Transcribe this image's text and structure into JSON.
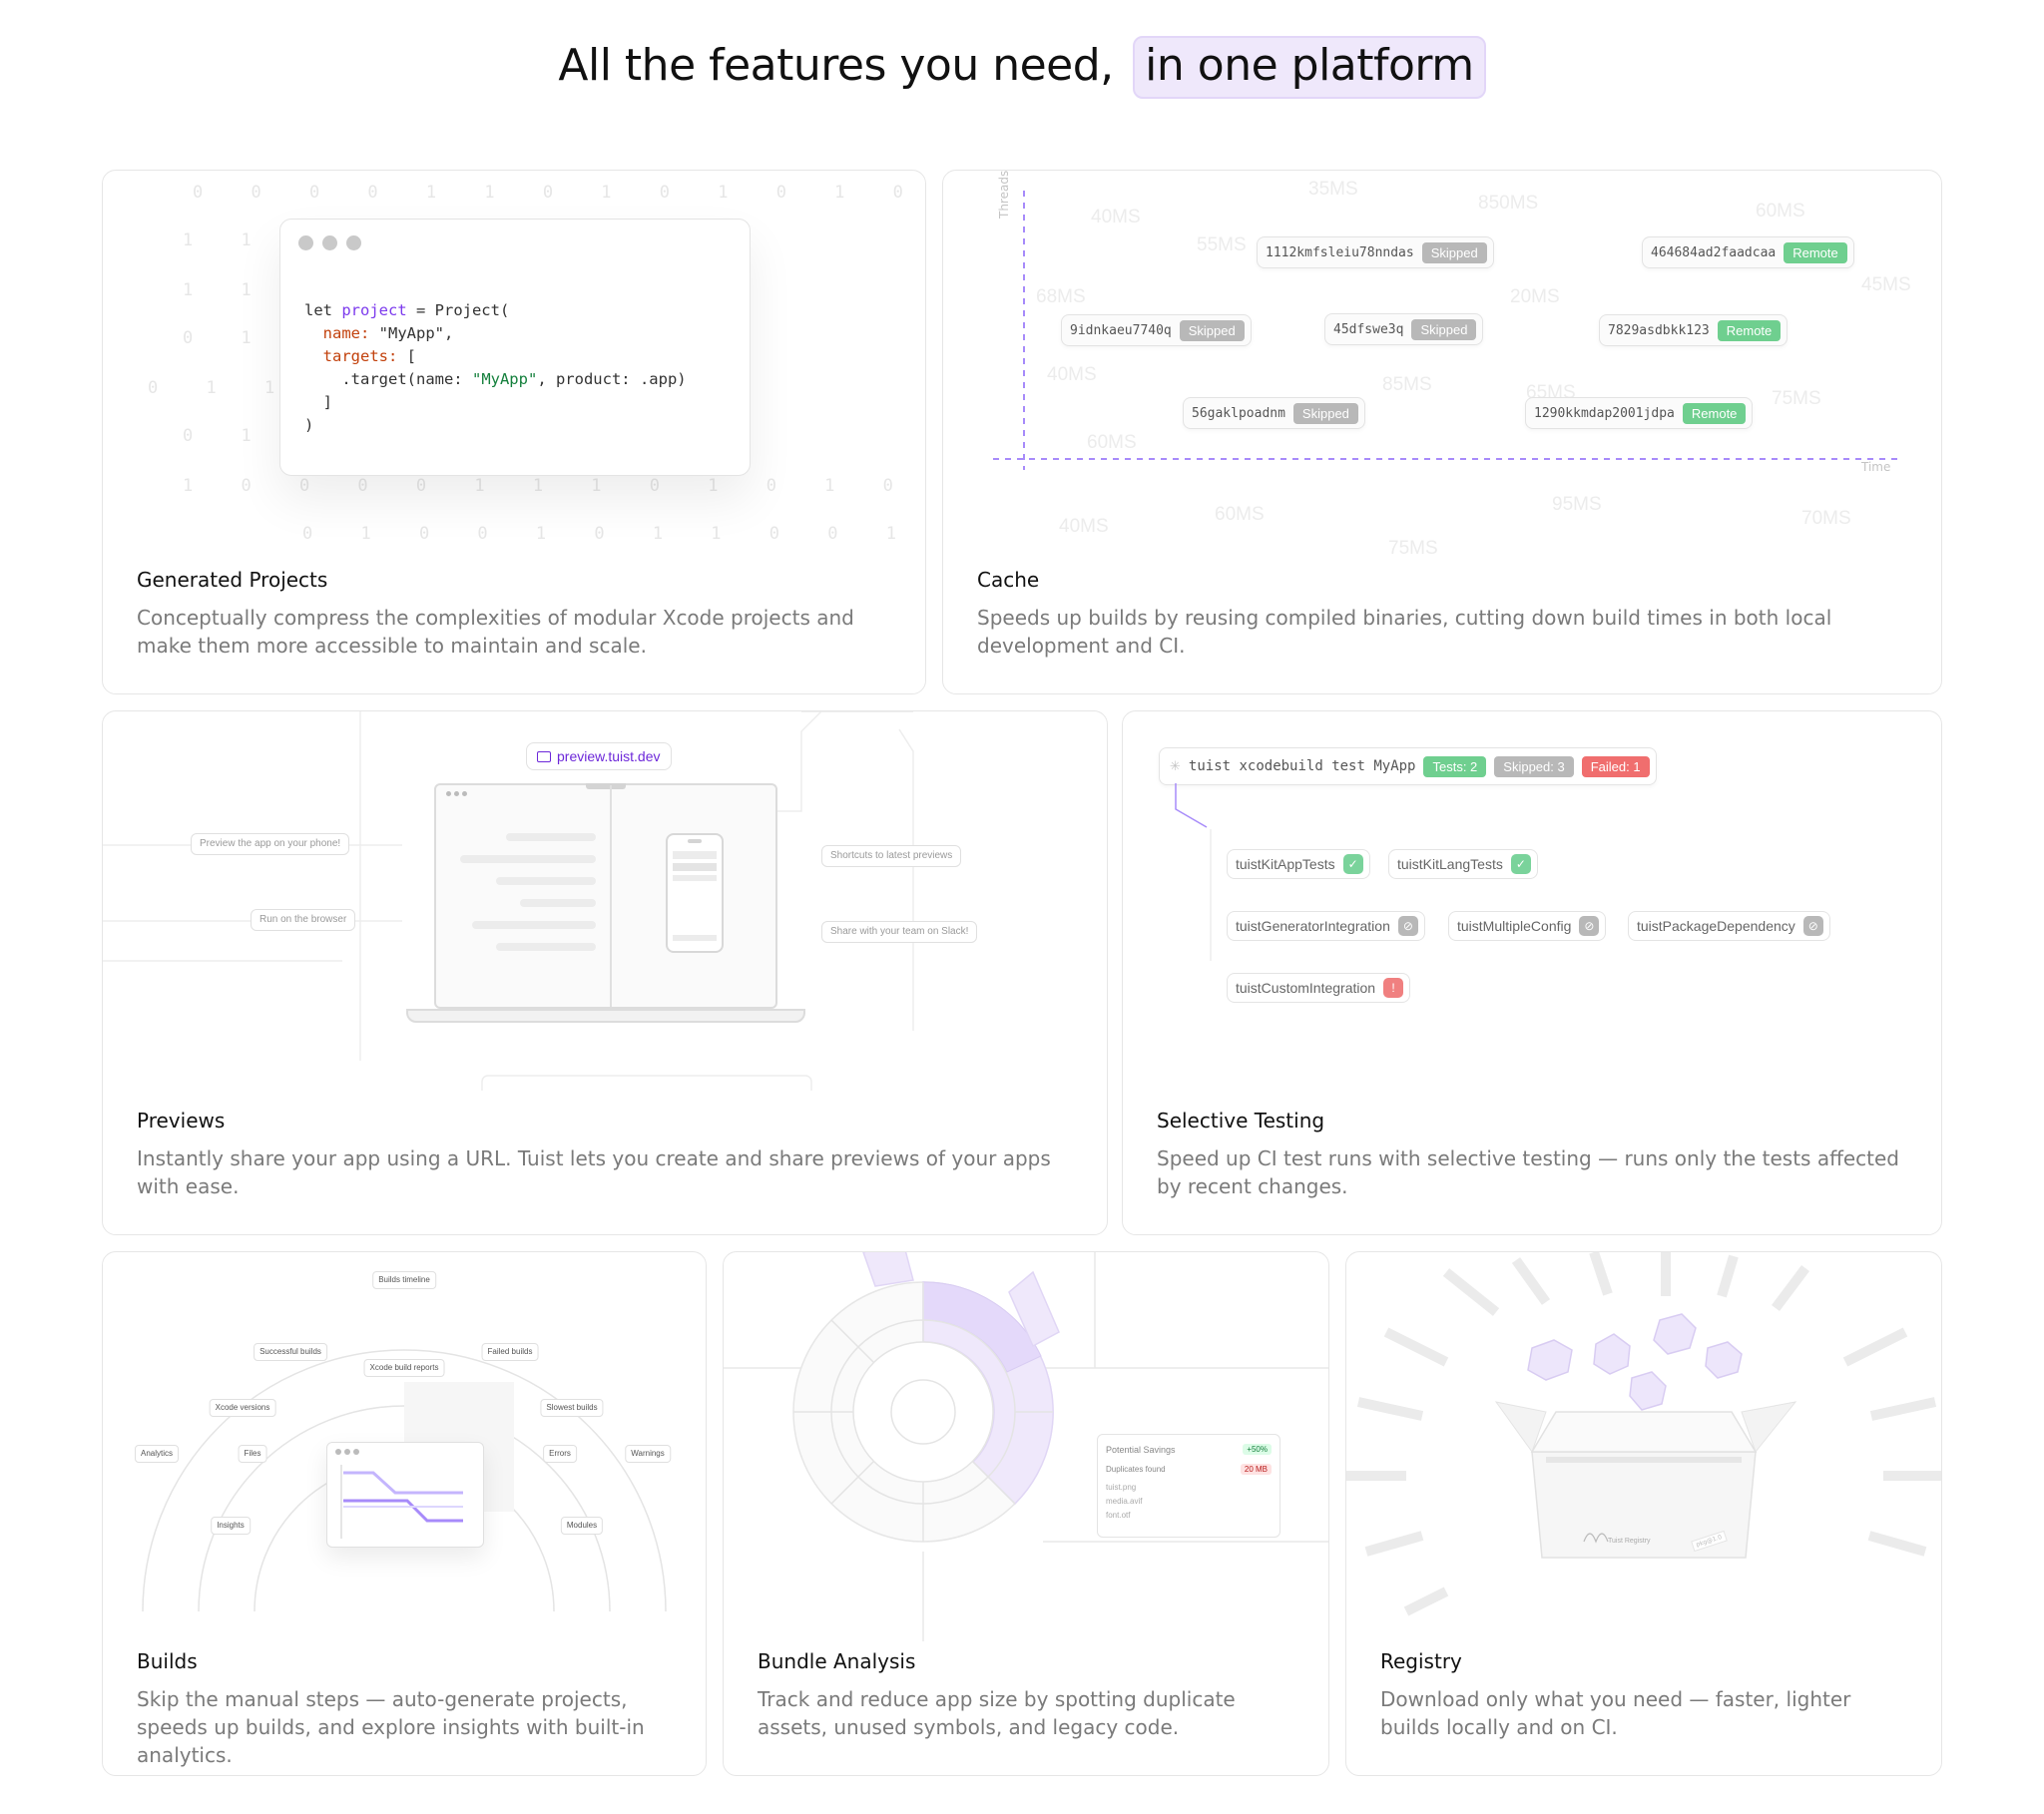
{
  "headline": {
    "prefix": "All the features you need,",
    "highlight": "in one platform"
  },
  "cards": {
    "generated": {
      "title": "Generated Projects",
      "desc": "Conceptually compress the complexities of modular Xcode projects and make them more accessible to maintain and scale.",
      "bits": [
        "0 0 0 0 1 1 0 1 0 1 0 1 0",
        "1 1 0           0 0 1 0",
        "1 1 0           0 1 0 1",
        "0 1 0           0 1 0 0",
        "0 1 1           0 1 0",
        "0 1 1           0 1 0",
        "1 0 0 0 0 1 1 1 0 1 0 1 0 1 0",
        "0 1 0 0 1 0 1 1 0 0 1 0 0"
      ]
    },
    "cache": {
      "title": "Cache",
      "desc": "Speeds up builds by reusing compiled binaries, cutting down build times in both local development and CI.",
      "axis_y": "Threads",
      "axis_x": "Time",
      "ms_labels": [
        "35MS",
        "40MS",
        "850MS",
        "60MS",
        "55MS",
        "68MS",
        "20MS",
        "45MS",
        "40MS",
        "85MS",
        "65MS",
        "75MS",
        "60MS",
        "60MS",
        "95MS",
        "40MS",
        "75MS",
        "70MS"
      ],
      "chips": [
        {
          "hash": "1112kmfsleiu78nndas",
          "status": "Skipped"
        },
        {
          "hash": "464684ad2faadcaa",
          "status": "Remote"
        },
        {
          "hash": "9idnkaeu7740q",
          "status": "Skipped"
        },
        {
          "hash": "45dfswe3q",
          "status": "Skipped"
        },
        {
          "hash": "7829asdbkk123",
          "status": "Remote"
        },
        {
          "hash": "56gaklpoadnm",
          "status": "Skipped"
        },
        {
          "hash": "1290kkmdap2001jdpa",
          "status": "Remote"
        }
      ]
    },
    "previews": {
      "title": "Previews",
      "desc": "Instantly share your app using a URL. Tuist lets you create and share previews of your apps with ease.",
      "url": "preview.tuist.dev",
      "pills": {
        "phone": "Preview the app on your phone!",
        "browser": "Run on the browser",
        "shortcuts": "Shortcuts to latest previews",
        "slack": "Share with your team on Slack!"
      }
    },
    "selective": {
      "title": "Selective Testing",
      "desc": "Speed up CI test runs with selective testing — runs only the tests affected by recent changes.",
      "command": "tuist xcodebuild test MyApp",
      "tests_badge": "Tests: 2",
      "skipped_badge": "Skipped: 3",
      "failed_badge": "Failed: 1",
      "tests": [
        {
          "name": "tuistKitAppTests",
          "status": "passed"
        },
        {
          "name": "tuistKitLangTests",
          "status": "passed"
        },
        {
          "name": "tuistGeneratorIntegration",
          "status": "skipped"
        },
        {
          "name": "tuistMultipleConfig",
          "status": "skipped"
        },
        {
          "name": "tuistPackageDependency",
          "status": "skipped"
        },
        {
          "name": "tuistCustomIntegration",
          "status": "failed"
        }
      ]
    },
    "builds": {
      "title": "Builds",
      "desc": "Skip the manual steps — auto-generate projects, speeds up builds, and explore insights with built-in analytics.",
      "labels": {
        "timeline": "Builds timeline",
        "successful": "Successful builds",
        "failed": "Failed builds",
        "reports": "Xcode build reports",
        "versions": "Xcode versions",
        "slowest": "Slowest builds",
        "analytics": "Analytics",
        "files": "Files",
        "errors": "Errors",
        "warnings": "Warnings",
        "insights": "Insights",
        "modules": "Modules"
      }
    },
    "bundle": {
      "title": "Bundle Analysis",
      "desc": "Track and reduce app size by spotting duplicate assets, unused symbols, and legacy code.",
      "panel": {
        "savings_label": "Potential Savings",
        "savings_value": "+50%",
        "dupes_label": "Duplicates found",
        "dupes_value": "20 MB",
        "files": [
          "tuist.png",
          "media.avif",
          "font.otf"
        ]
      }
    },
    "registry": {
      "title": "Registry",
      "desc": "Download only what you need — faster, lighter builds locally and on CI.",
      "box_label": "Tuist Registry",
      "box_tag": "pkg@1.0"
    }
  },
  "colors": {
    "accent": "#7c3aed",
    "highlight_bg": "#efe8fb",
    "remote": "#6fcf8f",
    "skipped": "#b8b8b8",
    "failed": "#f08080"
  }
}
